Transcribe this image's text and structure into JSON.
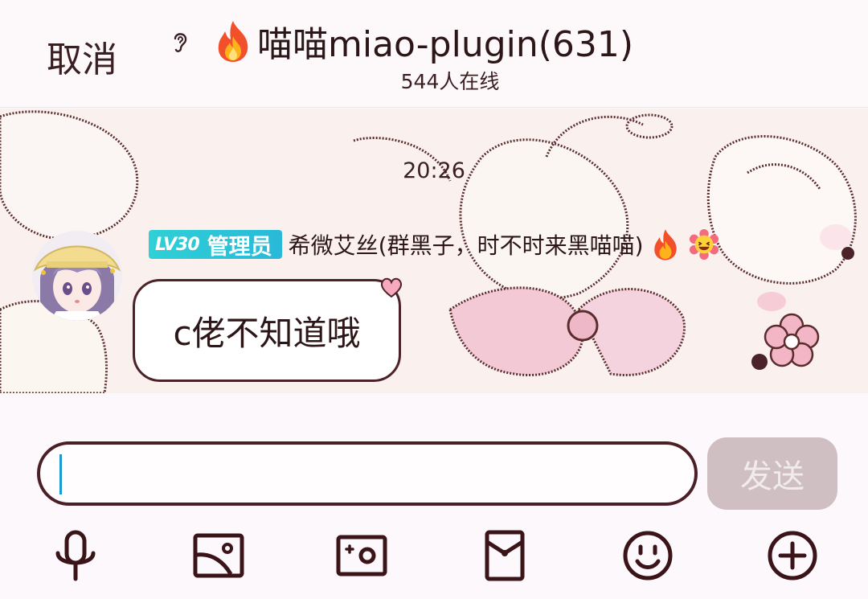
{
  "header": {
    "cancel_label": "取消",
    "title": "喵喵miao-plugin(631)",
    "online": "544人在线"
  },
  "chat": {
    "time": "20:26",
    "message": {
      "badge_level": "LV30",
      "badge_role": "管理员",
      "sender": "希微艾丝(群黑子，时不时来黑喵喵)",
      "text": "c佬不知道哦"
    }
  },
  "input": {
    "value": "",
    "send_label": "发送"
  },
  "toolbar": {
    "icons": [
      "microphone-icon",
      "image-icon",
      "camera-icon",
      "red-packet-icon",
      "emoji-icon",
      "plus-icon"
    ]
  },
  "colors": {
    "accent": "#4a1f26",
    "badge": "#2fd0d6",
    "send_disabled": "#cfbfc3"
  }
}
